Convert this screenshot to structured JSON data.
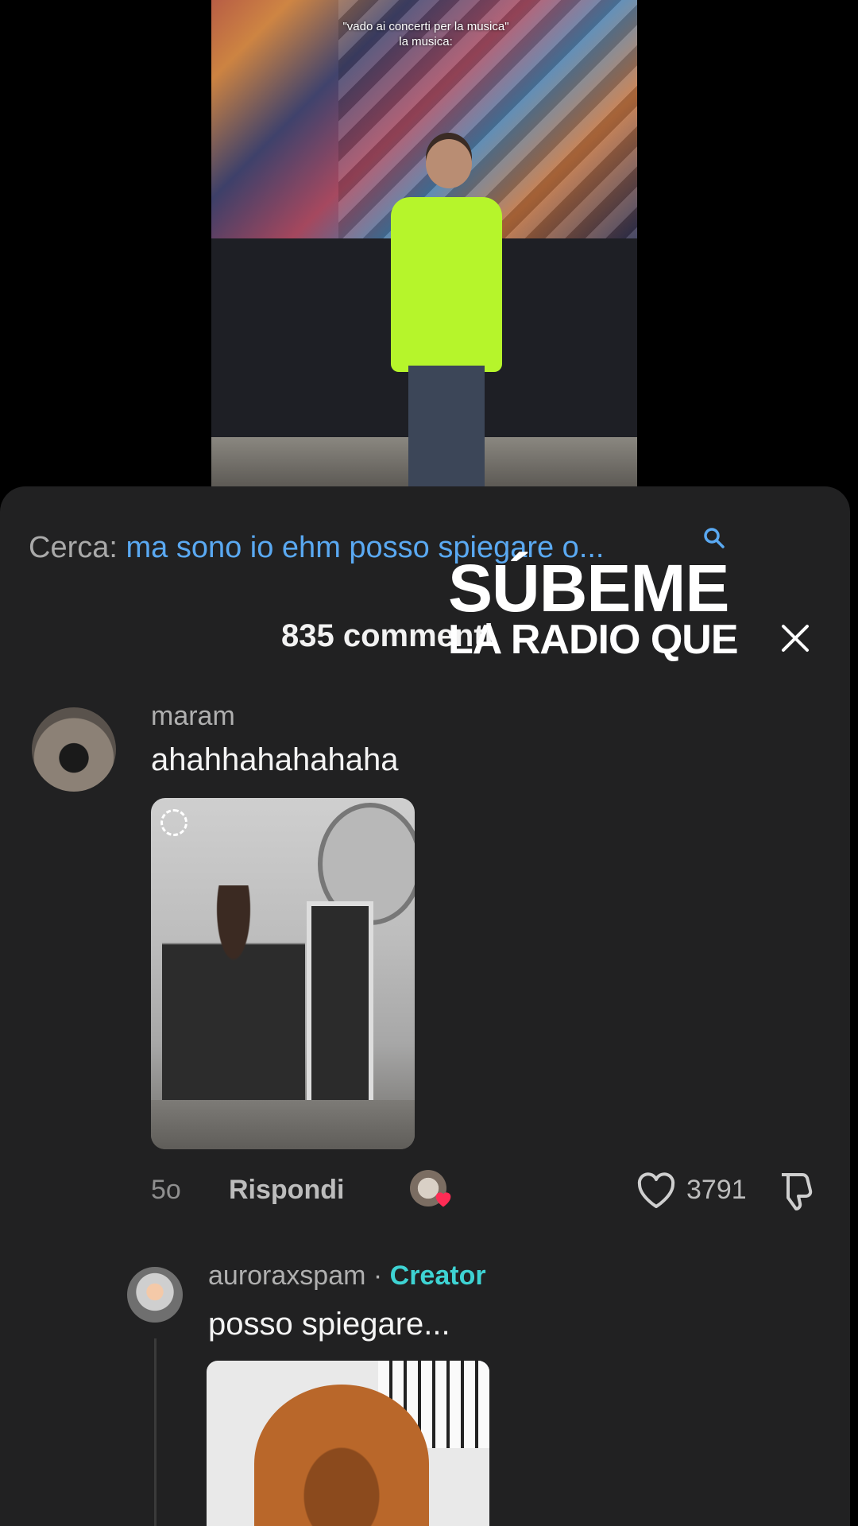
{
  "video": {
    "caption": "\"vado ai concerti per la musica\"\nla musica:"
  },
  "search": {
    "label": "Cerca:",
    "query": "ma sono io ehm posso spiegare o..."
  },
  "header": {
    "count": "835 commenti",
    "lyric_line1": "SÚBEME",
    "lyric_line2": "LA RADIO QUE"
  },
  "comments": [
    {
      "username": "maram",
      "text": "ahahhahahahaha",
      "time": "5o",
      "reply_label": "Rispondi",
      "likes": "3791"
    },
    {
      "username": "auroraxspam",
      "separator": " · ",
      "badge": "Creator",
      "text": "posso spiegare..."
    }
  ],
  "colors": {
    "panel": "#212122",
    "accent_blue": "#5aa9f2",
    "creator_teal": "#3ed3d3",
    "heart_red": "#fe2c55"
  }
}
